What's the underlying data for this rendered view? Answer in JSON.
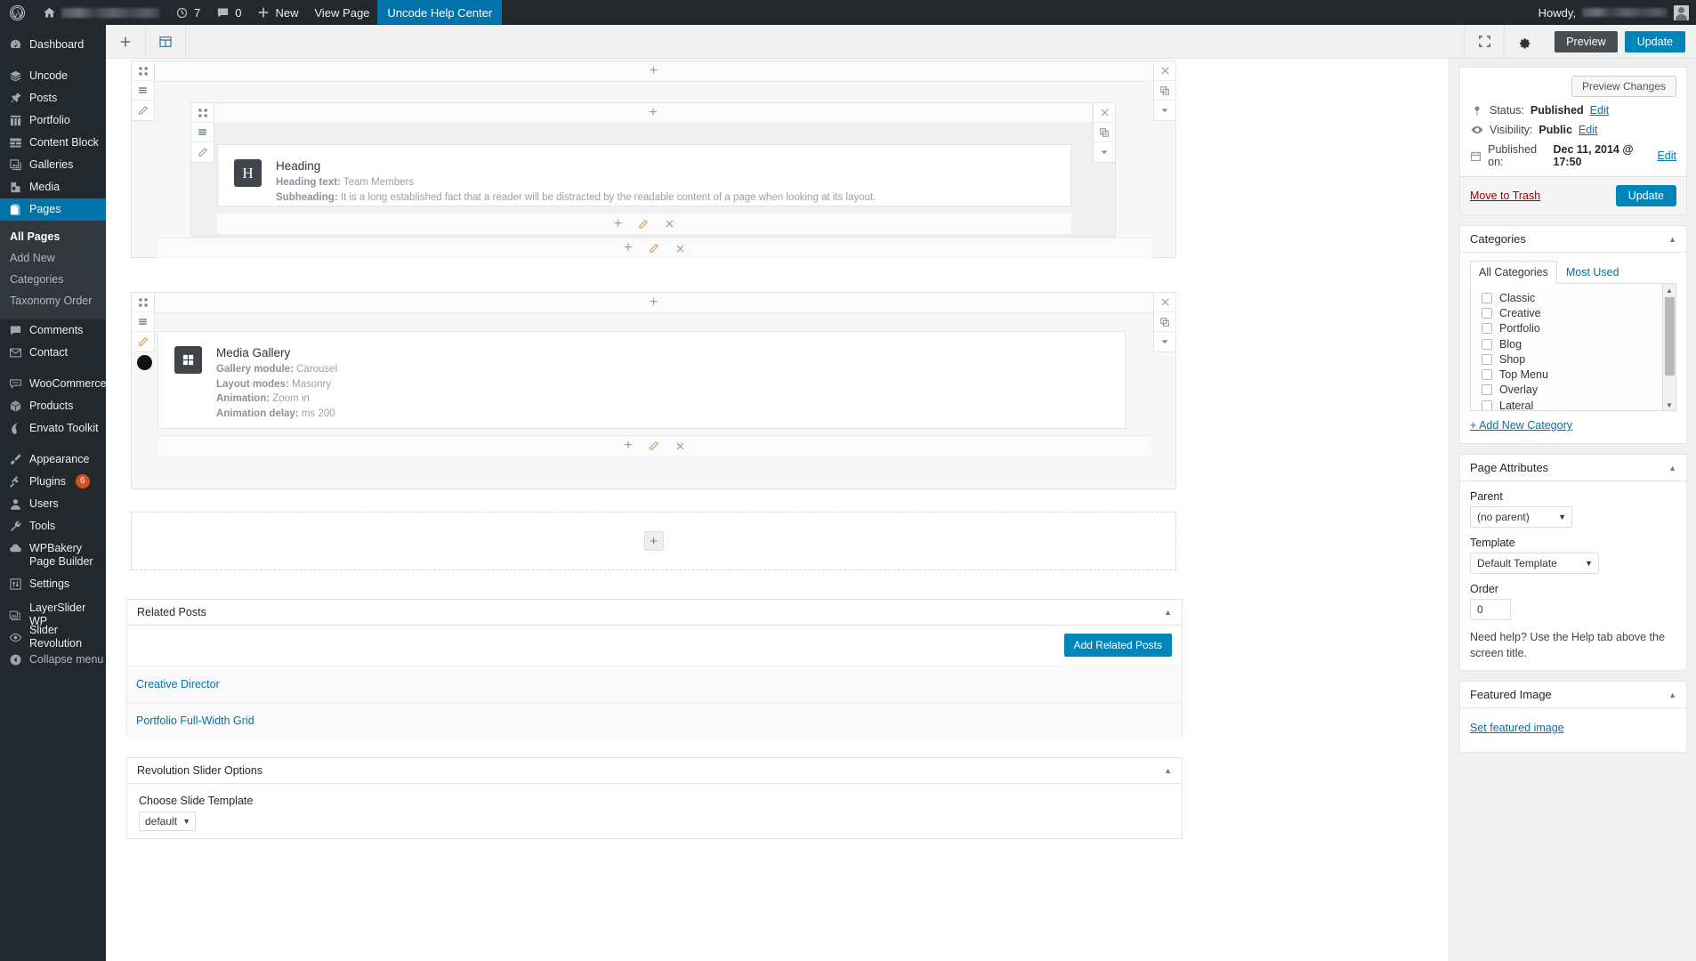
{
  "adminbar": {
    "site_name_redacted": true,
    "updates_icon": "updates-icon",
    "updates_count": "7",
    "comments_icon": "comment-icon",
    "comments_count": "0",
    "new_label": "New",
    "view_page_label": "View Page",
    "help_center_label": "Uncode Help Center",
    "help_center_bg": "#0073aa",
    "howdy_label": "Howdy,"
  },
  "sidebar": {
    "items": [
      {
        "label": "Dashboard",
        "icon": "dashboard-icon"
      },
      {
        "label": "Uncode",
        "icon": "layers-icon"
      },
      {
        "label": "Posts",
        "icon": "pin-icon"
      },
      {
        "label": "Portfolio",
        "icon": "portfolio-icon"
      },
      {
        "label": "Content Block",
        "icon": "content-block-icon"
      },
      {
        "label": "Galleries",
        "icon": "gallery-icon"
      },
      {
        "label": "Media",
        "icon": "media-icon"
      },
      {
        "label": "Pages",
        "icon": "pages-icon",
        "current": true
      },
      {
        "label": "Comments",
        "icon": "comment-icon"
      },
      {
        "label": "Contact",
        "icon": "envelope-icon"
      },
      {
        "label": "WooCommerce",
        "icon": "woo-icon"
      },
      {
        "label": "Products",
        "icon": "box-icon"
      },
      {
        "label": "Envato Toolkit",
        "icon": "envato-icon"
      },
      {
        "label": "Appearance",
        "icon": "brush-icon"
      },
      {
        "label": "Plugins",
        "icon": "plug-icon",
        "badge": "6"
      },
      {
        "label": "Users",
        "icon": "user-icon"
      },
      {
        "label": "Tools",
        "icon": "wrench-icon"
      },
      {
        "label": "WPBakery Page Builder",
        "icon": "cloud-icon"
      },
      {
        "label": "Settings",
        "icon": "settings-icon"
      },
      {
        "label": "LayerSlider WP",
        "icon": "layerslider-icon"
      },
      {
        "label": "Slider Revolution",
        "icon": "revslider-icon"
      },
      {
        "label": "Collapse menu",
        "icon": "collapse-icon"
      }
    ],
    "submenu": [
      {
        "label": "All Pages",
        "current": true
      },
      {
        "label": "Add New"
      },
      {
        "label": "Categories"
      },
      {
        "label": "Taxonomy Order"
      }
    ]
  },
  "editor_bar": {
    "add_element_icon": "plus-icon",
    "templates_icon": "layout-icon",
    "fullscreen_icon": "fullscreen-icon",
    "settings_icon": "gear-icon",
    "preview_label": "Preview",
    "update_label": "Update"
  },
  "canvas": {
    "add_icon": "plus-icon",
    "close_icon": "close-icon",
    "copy_icon": "copy-icon",
    "dropdown_icon": "chevron-down-icon",
    "expand_icon": "expand-icon",
    "drag_icon": "drag-handle-icon",
    "edit_icon": "pencil-icon",
    "elements": [
      {
        "icon_glyph": "H",
        "icon_name": "heading-icon",
        "title": "Heading",
        "meta": [
          {
            "key": "Heading text:",
            "value": " Team Members"
          },
          {
            "key": "Subheading:",
            "value": " It is a long established fact that a reader will be distracted by the readable content of a page when looking at its layout."
          }
        ]
      },
      {
        "icon_glyph": "grid",
        "icon_name": "media-gallery-icon",
        "title": "Media Gallery",
        "meta": [
          {
            "key": "Gallery module:",
            "value": " Carousel"
          },
          {
            "key": "Layout modes:",
            "value": " Masonry"
          },
          {
            "key": "Animation:",
            "value": " Zoom in"
          },
          {
            "key": "Animation delay:",
            "value": " ms 200"
          }
        ]
      }
    ]
  },
  "related_posts": {
    "title": "Related Posts",
    "add_button": "Add Related Posts",
    "items": [
      {
        "label": "Creative Director"
      },
      {
        "label": "Portfolio Full-Width Grid"
      }
    ]
  },
  "revslider": {
    "title": "Revolution Slider Options",
    "field_label": "Choose Slide Template",
    "selected": "default"
  },
  "publish": {
    "preview_changes_label": "Preview Changes",
    "status_label": "Status:",
    "status_value": "Published",
    "visibility_label": "Visibility:",
    "visibility_value": "Public",
    "published_label": "Published on:",
    "published_value": "Dec 11, 2014 @ 17:50",
    "edit_label": "Edit",
    "trash_label": "Move to Trash",
    "update_label": "Update"
  },
  "categories": {
    "title": "Categories",
    "tabs": [
      {
        "label": "All Categories",
        "active": true
      },
      {
        "label": "Most Used",
        "active": false
      }
    ],
    "items": [
      {
        "label": "Classic",
        "checked": false
      },
      {
        "label": "Creative",
        "checked": false
      },
      {
        "label": "Portfolio",
        "checked": false
      },
      {
        "label": "Blog",
        "checked": false
      },
      {
        "label": "Shop",
        "checked": false
      },
      {
        "label": "Top Menu",
        "checked": false
      },
      {
        "label": "Overlay",
        "checked": false
      },
      {
        "label": "Lateral",
        "checked": false
      }
    ],
    "add_new_label": "+ Add New Category"
  },
  "page_attributes": {
    "title": "Page Attributes",
    "parent_label": "Parent",
    "parent_value": "(no parent)",
    "template_label": "Template",
    "template_value": "Default Template",
    "order_label": "Order",
    "order_value": "0",
    "help_text": "Need help? Use the Help tab above the screen title."
  },
  "featured_image": {
    "title": "Featured Image",
    "set_label": "Set featured image"
  },
  "colors": {
    "accent": "#0073aa",
    "button": "#0085ba",
    "admin_bg": "#23282d",
    "submenu_bg": "#32373c",
    "badge": "#d54e21",
    "trash": "#a00"
  }
}
